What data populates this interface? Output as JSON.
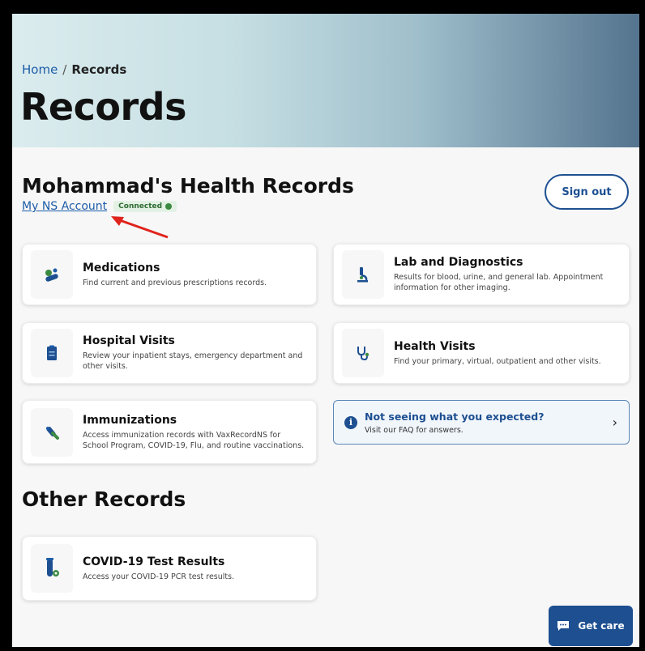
{
  "breadcrumb": {
    "home": "Home",
    "separator": "/",
    "current": "Records"
  },
  "hero": {
    "title": "Records"
  },
  "section": {
    "title": "Mohammad's Health Records"
  },
  "account": {
    "link": "My NS Account",
    "badge": "Connected"
  },
  "signout": {
    "label": "Sign out"
  },
  "cards": [
    {
      "title": "Medications",
      "desc": "Find current and previous prescriptions records.",
      "icon": "pills-icon"
    },
    {
      "title": "Lab and Diagnostics",
      "desc": "Results for blood, urine, and general lab. Appointment information for other imaging.",
      "icon": "microscope-icon"
    },
    {
      "title": "Hospital Visits",
      "desc": "Review your inpatient stays, emergency department and other visits.",
      "icon": "clipboard-icon"
    },
    {
      "title": "Health Visits",
      "desc": "Find your primary, virtual, outpatient and other visits.",
      "icon": "stethoscope-icon"
    },
    {
      "title": "Immunizations",
      "desc": "Access immunization records with VaxRecordNS for School Program, COVID-19, Flu, and routine vaccinations.",
      "icon": "syringe-icon"
    }
  ],
  "faq": {
    "title": "Not seeing what you expected?",
    "desc": "Visit our FAQ for answers."
  },
  "other": {
    "title": "Other Records",
    "card": {
      "title": "COVID-19 Test Results",
      "desc": "Access your COVID-19 PCR test results.",
      "icon": "test-tube-icon"
    }
  },
  "getcare": {
    "label": "Get care"
  },
  "colors": {
    "primary": "#1d4f91",
    "link": "#1d5ca8",
    "connected": "#3c8a42",
    "annotation_arrow": "#e0231c"
  }
}
